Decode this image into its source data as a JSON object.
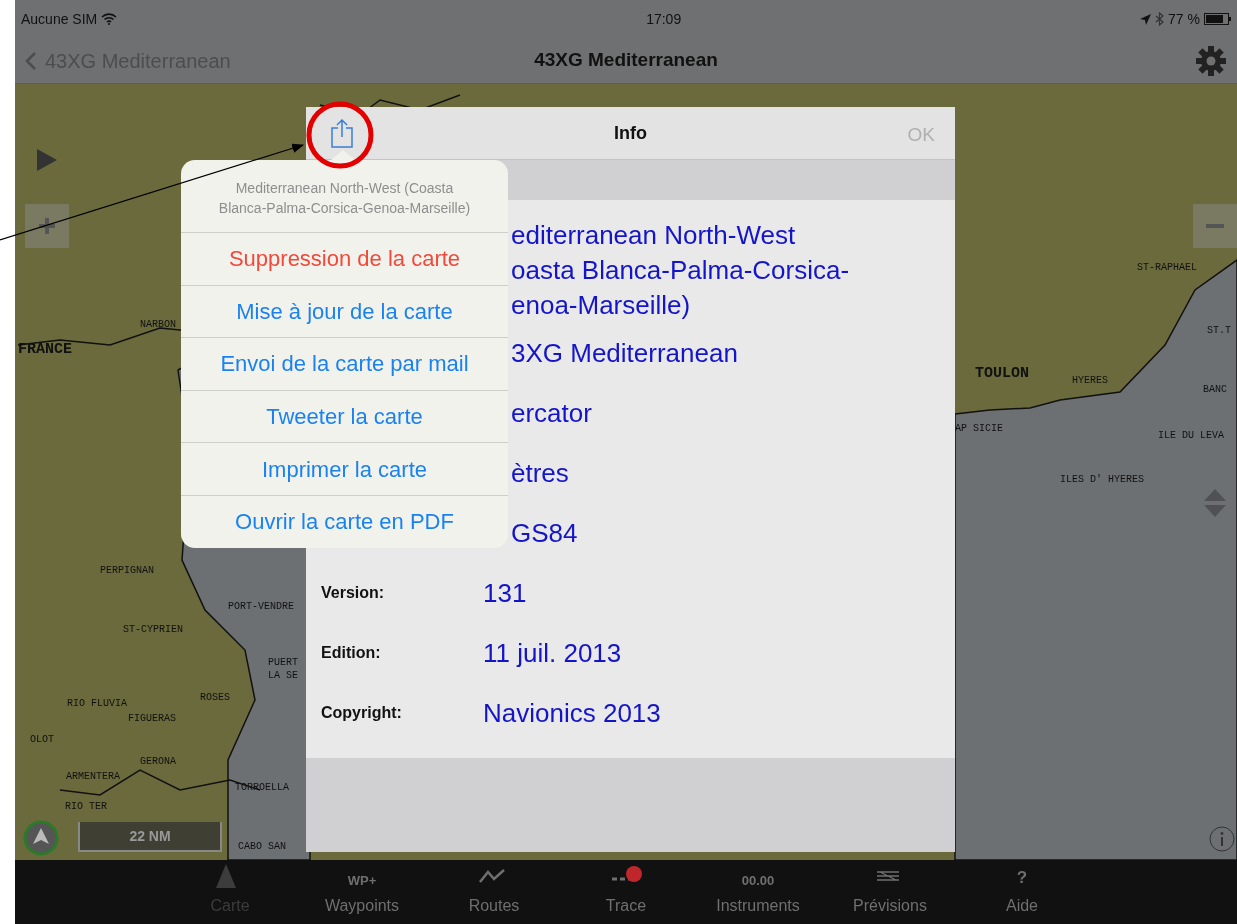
{
  "status_bar": {
    "carrier": "Aucune SIM",
    "time": "17:09",
    "battery": "77 %"
  },
  "nav_bar": {
    "back": "43XG Mediterranean",
    "title": "43XG Mediterranean"
  },
  "map": {
    "labels": [
      {
        "text": "NARBON",
        "kind": "town"
      },
      {
        "text": "FRANCE",
        "kind": "major"
      },
      {
        "text": "PERPIGNAN",
        "kind": "town"
      },
      {
        "text": "PORT-VENDRE",
        "kind": "town"
      },
      {
        "text": "ST-CYPRIEN",
        "kind": "town"
      },
      {
        "text": "PUERT",
        "kind": "town"
      },
      {
        "text": "LA SE",
        "kind": "town"
      },
      {
        "text": "ROSES",
        "kind": "town"
      },
      {
        "text": "RIO FLUVIA",
        "kind": "town"
      },
      {
        "text": "FIGUERAS",
        "kind": "town"
      },
      {
        "text": "OLOT",
        "kind": "town"
      },
      {
        "text": "GERONA",
        "kind": "town"
      },
      {
        "text": "ARMENTERA",
        "kind": "town"
      },
      {
        "text": "RIO TER",
        "kind": "town"
      },
      {
        "text": "TORROELLA",
        "kind": "town"
      },
      {
        "text": "CABO SAN",
        "kind": "town"
      },
      {
        "text": "ST-RAPHAEL",
        "kind": "town"
      },
      {
        "text": "ST.T",
        "kind": "town"
      },
      {
        "text": "TOULON",
        "kind": "major"
      },
      {
        "text": "HYERES",
        "kind": "town"
      },
      {
        "text": "BANC",
        "kind": "town"
      },
      {
        "text": "AP SICIE",
        "kind": "town"
      },
      {
        "text": "ILE DU LEVA",
        "kind": "town"
      },
      {
        "text": "ILES D' HYERES",
        "kind": "town"
      }
    ],
    "scale": "22 NM"
  },
  "info_panel": {
    "title": "Info",
    "ok_button": {
      "label": "OK",
      "disabled": true
    },
    "rows": [
      {
        "value_lines": [
          "editerranean North-West",
          "oasta Blanca-Palma-Corsica-",
          "enoa-Marseille)"
        ]
      },
      {
        "value": "3XG Mediterranean"
      },
      {
        "value": "ercator"
      },
      {
        "value": "ètres"
      },
      {
        "value": "GS84"
      },
      {
        "label": "Version:",
        "value": "131"
      },
      {
        "label": "Edition:",
        "value": "11 juil. 2013"
      },
      {
        "label": "Copyright:",
        "value": "Navionics 2013"
      }
    ]
  },
  "share_menu": {
    "title": "Mediterranean North-West (Coasta Blanca-Palma-Corsica-Genoa-Marseille)",
    "items": [
      {
        "label": "Suppression de la carte",
        "kind": "destructive"
      },
      {
        "label": "Mise à jour de la carte",
        "kind": "default"
      },
      {
        "label": "Envoi de la carte par mail",
        "kind": "default"
      },
      {
        "label": "Tweeter la carte",
        "kind": "default"
      },
      {
        "label": "Imprimer la carte",
        "kind": "default"
      },
      {
        "label": "Ouvrir la carte en PDF",
        "kind": "default"
      }
    ]
  },
  "tab_bar": [
    {
      "label": "Carte",
      "kind": "chart",
      "selected": true
    },
    {
      "label": "Waypoints",
      "kind": "waypoints",
      "icon_text": "WP+",
      "selected": false
    },
    {
      "label": "Routes",
      "kind": "routes",
      "selected": false
    },
    {
      "label": "Trace",
      "kind": "trace",
      "selected": false
    },
    {
      "label": "Instruments",
      "kind": "instruments",
      "icon_text": "00.00",
      "selected": false
    },
    {
      "label": "Prévisions",
      "kind": "forecast",
      "selected": false
    },
    {
      "label": "Aide",
      "kind": "help",
      "icon_text": "?",
      "selected": false
    }
  ]
}
